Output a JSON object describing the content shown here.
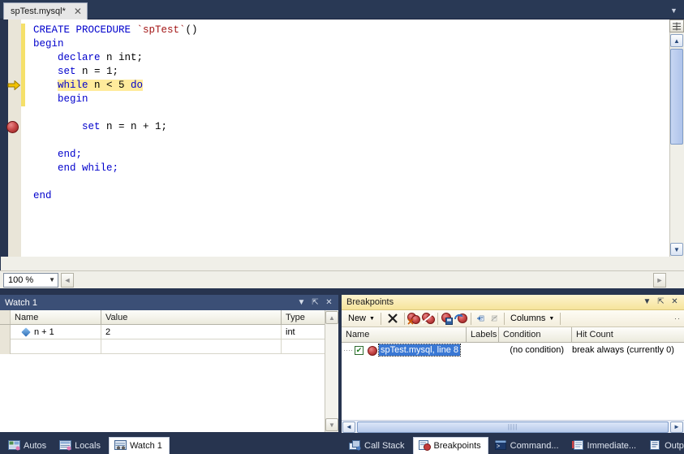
{
  "window": {
    "tab_chevron_icon": "chevron-down-icon"
  },
  "editor_tab": {
    "label": "spTest.mysql*",
    "close_icon": "close-icon"
  },
  "code": {
    "lines": [
      {
        "indent": 0,
        "tokens": [
          {
            "t": "CREATE PROCEDURE ",
            "c": "kw"
          },
          {
            "t": "`spTest`",
            "c": "id"
          },
          {
            "t": "()",
            "c": "pl"
          }
        ]
      },
      {
        "indent": 0,
        "tokens": [
          {
            "t": "begin",
            "c": "kw"
          }
        ]
      },
      {
        "indent": 1,
        "tokens": [
          {
            "t": "declare ",
            "c": "kw"
          },
          {
            "t": "n int;",
            "c": "pl"
          }
        ]
      },
      {
        "indent": 1,
        "tokens": [
          {
            "t": "set ",
            "c": "kw"
          },
          {
            "t": "n = 1;",
            "c": "pl"
          }
        ]
      },
      {
        "indent": 1,
        "highlight": true,
        "tokens": [
          {
            "t": "while ",
            "c": "kw"
          },
          {
            "t": "n < 5 ",
            "c": "pl"
          },
          {
            "t": "do",
            "c": "kw"
          }
        ]
      },
      {
        "indent": 1,
        "tokens": [
          {
            "t": "begin",
            "c": "kw"
          }
        ]
      },
      {
        "indent": 1,
        "tokens": []
      },
      {
        "indent": 2,
        "tokens": [
          {
            "t": "set ",
            "c": "kw"
          },
          {
            "t": "n = n + 1;",
            "c": "pl"
          }
        ]
      },
      {
        "indent": 1,
        "tokens": []
      },
      {
        "indent": 1,
        "tokens": [
          {
            "t": "end;",
            "c": "kw"
          }
        ]
      },
      {
        "indent": 1,
        "tokens": [
          {
            "t": "end ",
            "c": "kw"
          },
          {
            "t": "while;",
            "c": "kw"
          }
        ]
      },
      {
        "indent": 1,
        "tokens": []
      },
      {
        "indent": 0,
        "tokens": [
          {
            "t": "end",
            "c": "kw"
          }
        ]
      }
    ],
    "execution_marker_icon": "yellow-arrow-icon",
    "breakpoint_marker_icon": "breakpoint-dot-icon"
  },
  "zoom_bar": {
    "zoom_level": "100 %",
    "dropdown_icon": "chevron-down-icon",
    "scroll_left_icon": "chevron-left-icon",
    "scroll_right_icon": "chevron-right-icon"
  },
  "editor_scrollbar": {
    "split_icon": "split-view-icon",
    "up_icon": "chevron-up-icon",
    "down_icon": "chevron-down-icon"
  },
  "watch_panel": {
    "title": "Watch 1",
    "dropdown_icon": "chevron-down-icon",
    "pin_icon": "pin-icon",
    "close_icon": "close-icon",
    "columns": [
      "Name",
      "Value",
      "Type"
    ],
    "rows": [
      {
        "icon": "watch-item-icon",
        "name": "n + 1",
        "value": "2",
        "type": "int"
      },
      {
        "icon": "",
        "name": "",
        "value": "",
        "type": ""
      }
    ],
    "scroll_up_icon": "chevron-up-icon",
    "scroll_down_icon": "chevron-down-icon"
  },
  "breakpoints_panel": {
    "title": "Breakpoints",
    "dropdown_icon": "chevron-down-icon",
    "pin_icon": "pin-icon",
    "close_icon": "close-icon",
    "toolbar": {
      "new_label": "New",
      "new_dropdown_icon": "chevron-down-icon",
      "delete_icon": "delete-breakpoint-icon",
      "delete_all_icon": "delete-all-breakpoints-icon",
      "disable_all_icon": "disable-all-breakpoints-icon",
      "export_icon": "export-breakpoints-icon",
      "import_icon": "import-breakpoints-icon",
      "goto_source_icon": "goto-source-code-icon",
      "goto_disassembly_icon": "goto-disassembly-icon",
      "columns_label": "Columns",
      "columns_dropdown_icon": "chevron-down-icon",
      "overflow_icon": "toolbar-overflow-icon"
    },
    "columns": [
      "Name",
      "Labels",
      "Condition",
      "Hit Count"
    ],
    "rows": [
      {
        "checked": true,
        "check_icon": "checkbox-checked-icon",
        "breakpoint_icon": "breakpoint-dot-icon",
        "name": "spTest.mysql, line 8",
        "labels": "",
        "condition": "(no condition)",
        "hit_count": "break always (currently 0)"
      }
    ],
    "hscroll_left_icon": "chevron-left-icon",
    "hscroll_right_icon": "chevron-right-icon",
    "hscroll_grip_icon": "scrollbar-grip-icon"
  },
  "bottom_tabs_left": [
    {
      "label": "Autos",
      "icon": "autos-icon",
      "active": false
    },
    {
      "label": "Locals",
      "icon": "locals-icon",
      "active": false
    },
    {
      "label": "Watch 1",
      "icon": "watch-icon",
      "active": true
    }
  ],
  "bottom_tabs_right": [
    {
      "label": "Call Stack",
      "icon": "call-stack-icon",
      "active": false
    },
    {
      "label": "Breakpoints",
      "icon": "breakpoints-icon",
      "active": true
    },
    {
      "label": "Command...",
      "icon": "command-window-icon",
      "active": false
    },
    {
      "label": "Immediate...",
      "icon": "immediate-window-icon",
      "active": false
    },
    {
      "label": "Output",
      "icon": "output-window-icon",
      "active": false
    }
  ],
  "colors": {
    "chrome": "#27344f",
    "keyword": "#0000cc",
    "identifier": "#a31515",
    "highlight": "#ffeb9c",
    "selection": "#3a78d4",
    "breakpoint": "#c94a4a",
    "exec_arrow": "#f2c200"
  }
}
